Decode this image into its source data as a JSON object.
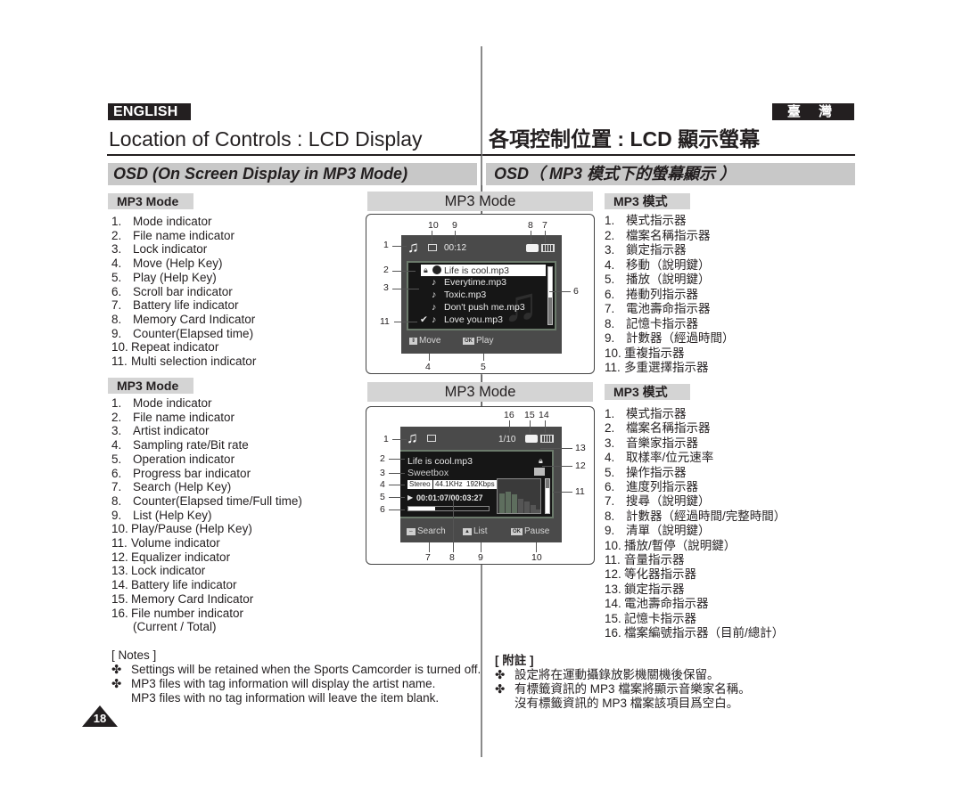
{
  "header": {
    "lang_en": "ENGLISH",
    "lang_zh": "臺 灣",
    "title_en": "Location of Controls : LCD Display",
    "title_zh": "各項控制位置 : LCD 顯示螢幕",
    "section_en": "OSD (On Screen Display in MP3 Mode)",
    "section_zh": "OSD（ MP3 模式下的螢幕顯示 ）"
  },
  "list1": {
    "tab_en": "MP3 Mode",
    "tab_zh": "MP3 模式",
    "items_en": [
      "Mode indicator",
      "File name indicator",
      "Lock indicator",
      "Move (Help Key)",
      "Play (Help Key)",
      "Scroll bar indicator",
      "Battery life indicator",
      "Memory Card Indicator",
      "Counter(Elapsed time)",
      "Repeat indicator",
      "Multi selection indicator"
    ],
    "items_zh": [
      "模式指示器",
      "檔案名稱指示器",
      "鎖定指示器",
      "移動（說明鍵）",
      "播放（說明鍵）",
      "捲動列指示器",
      "電池壽命指示器",
      "記憶卡指示器",
      "計數器（經過時間）",
      "重複指示器",
      "多重選擇指示器"
    ]
  },
  "list2": {
    "tab_en": "MP3 Mode",
    "tab_zh": "MP3 模式",
    "items_en": [
      "Mode indicator",
      "File name indicator",
      "Artist indicator",
      "Sampling rate/Bit rate",
      "Operation indicator",
      "Progress bar indicator",
      "Search (Help Key)",
      "Counter(Elapsed time/Full time)",
      "List (Help Key)",
      "Play/Pause (Help Key)",
      "Volume indicator",
      "Equalizer indicator",
      "Lock indicator",
      "Battery life indicator",
      "Memory Card Indicator",
      "File number indicator"
    ],
    "item16_cont": "(Current / Total)",
    "items_zh": [
      "模式指示器",
      "檔案名稱指示器",
      "音樂家指示器",
      "取樣率/位元速率",
      "操作指示器",
      "進度列指示器",
      "搜尋（說明鍵）",
      "計數器（經過時間/完整時間）",
      "清單（說明鍵）",
      "播放/暫停（說明鍵）",
      "音量指示器",
      "等化器指示器",
      "鎖定指示器",
      "電池壽命指示器",
      "記憶卡指示器",
      "檔案編號指示器（目前/總計）"
    ]
  },
  "figure1": {
    "header": "MP3 Mode",
    "counter": "00:12",
    "files": [
      "Life is cool.mp3",
      "Everytime.mp3",
      "Toxic.mp3",
      "Don't push me.mp3",
      "Love you.mp3"
    ],
    "help_move": "Move",
    "help_play": "Play",
    "key_ok": "OK",
    "callouts": {
      "c1": "1",
      "c2": "2",
      "c3": "3",
      "c4": "4",
      "c5": "5",
      "c6": "6",
      "c7": "7",
      "c8": "8",
      "c9": "9",
      "c10": "10",
      "c11": "11"
    }
  },
  "figure2": {
    "header": "MP3 Mode",
    "file_number": "1/10",
    "file_name": "Life is cool.mp3",
    "artist": "Sweetbox",
    "audio_mode": "Stereo",
    "sampling_rate": "44.1KHz",
    "bit_rate": "192Kbps",
    "time": "00:01:07/00:03:27",
    "progress": 0.33,
    "volume": 0.75,
    "help_search": "Search",
    "help_list": "List",
    "help_pause": "Pause",
    "key_ok": "OK",
    "callouts": {
      "c1": "1",
      "c2": "2",
      "c3": "3",
      "c4": "4",
      "c5": "5",
      "c6": "6",
      "c7": "7",
      "c8": "8",
      "c9": "9",
      "c10": "10",
      "c11": "11",
      "c12": "12",
      "c13": "13",
      "c14": "14",
      "c15": "15",
      "c16": "16"
    }
  },
  "notes_en": {
    "heading": "[ Notes ]",
    "bullet": "✤",
    "items": [
      "Settings will be retained when the Sports Camcorder is turned off.",
      "MP3 files with tag information will display the artist name."
    ],
    "cont": "MP3 files with no tag information will leave the item blank."
  },
  "notes_zh": {
    "heading": "[ 附註 ]",
    "bullet": "✤",
    "items": [
      "設定將在運動攝錄放影機關機後保留。",
      "有標籤資訊的 MP3 檔案將顯示音樂家名稱。"
    ],
    "cont": "沒有標籤資訊的 MP3 檔案該項目爲空白。"
  },
  "page_number": "18"
}
